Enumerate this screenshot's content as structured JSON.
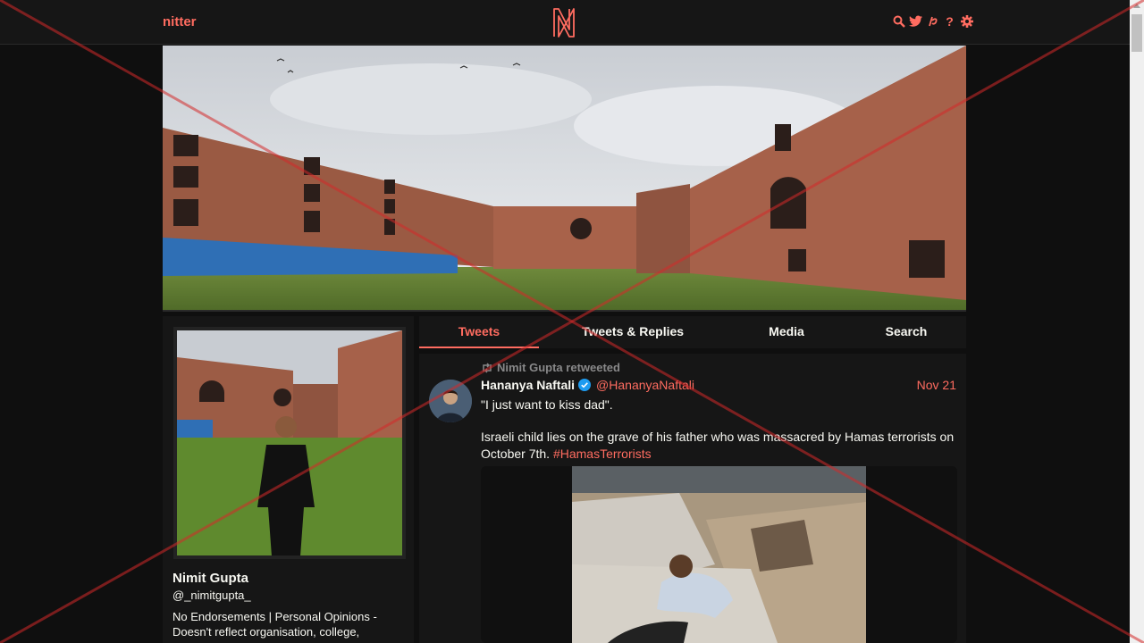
{
  "navbar": {
    "brand": "nitter",
    "logo_letter": "N",
    "icons": [
      "search-icon",
      "twitter-bird-icon",
      "rss-icon",
      "help-icon",
      "gear-icon"
    ],
    "help_glyph": "?"
  },
  "colors": {
    "accent": "#ff6c60",
    "background": "#0f0f0f",
    "panel": "#161616",
    "text": "#f8f8f2",
    "muted": "#888889",
    "verified": "#1d9bf0"
  },
  "profile": {
    "fullname": "Nimit Gupta",
    "username": "@_nimitgupta_",
    "bio": "No Endorsements | Personal Opinions - Doesn't reflect organisation, college,"
  },
  "tabs": [
    {
      "label": "Tweets",
      "active": true
    },
    {
      "label": "Tweets & Replies",
      "active": false
    },
    {
      "label": "Media",
      "active": false
    },
    {
      "label": "Search",
      "active": false
    }
  ],
  "tweet": {
    "retweet_label": "Nimit Gupta retweeted",
    "fullname": "Hananya Naftali",
    "username": "@HananyaNaftali",
    "date": "Nov 21",
    "line1": "\"I just want to kiss dad\".",
    "line2": "Israeli child lies on the grave of his father who was massacred by Hamas terrorists on October 7th.",
    "hashtag": "#HamasTerrorists"
  }
}
